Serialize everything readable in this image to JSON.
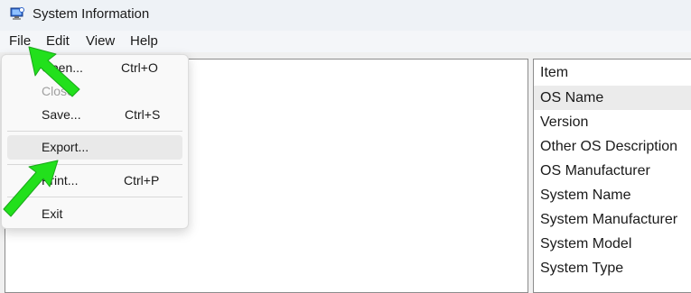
{
  "window": {
    "title": "System Information",
    "icon": "system-information-app-icon"
  },
  "menubar": {
    "items": [
      "File",
      "Edit",
      "View",
      "Help"
    ]
  },
  "file_menu": {
    "open": {
      "label": "Open...",
      "shortcut": "Ctrl+O"
    },
    "close": {
      "label": "Close",
      "shortcut": ""
    },
    "save": {
      "label": "Save...",
      "shortcut": "Ctrl+S"
    },
    "export": {
      "label": "Export...",
      "shortcut": ""
    },
    "print": {
      "label": "Print...",
      "shortcut": "Ctrl+P"
    },
    "exit": {
      "label": "Exit",
      "shortcut": ""
    }
  },
  "details": {
    "column_header": "Item",
    "rows": [
      "OS Name",
      "Version",
      "Other OS Description",
      "OS Manufacturer",
      "System Name",
      "System Manufacturer",
      "System Model",
      "System Type"
    ],
    "selected_row": "OS Name"
  },
  "annotations": {
    "arrow_color": "#22e01c",
    "arrows": [
      "pointer-arrow-file",
      "pointer-arrow-export"
    ]
  }
}
